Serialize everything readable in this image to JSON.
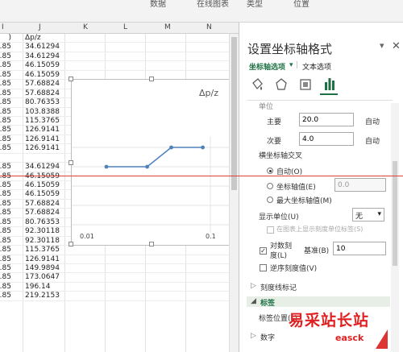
{
  "ribbon": {
    "items": [
      "数据",
      "在线图表",
      "类型",
      "位置"
    ]
  },
  "colhdr": {
    "I": "I",
    "J": "J",
    "K": "K",
    "L": "L",
    "M": "M",
    "N": "N"
  },
  "sheet": {
    "header_row": {
      "i": ")",
      "j": "Δp/z"
    },
    "rows": [
      {
        "i": "0.85",
        "j": "34.61294"
      },
      {
        "i": "0.85",
        "j": "34.61294"
      },
      {
        "i": "0.85",
        "j": "46.15059"
      },
      {
        "i": "0.85",
        "j": "46.15059"
      },
      {
        "i": "0.85",
        "j": "57.68824"
      },
      {
        "i": "0.85",
        "j": "57.68824"
      },
      {
        "i": "0.85",
        "j": "80.76353"
      },
      {
        "i": "0.85",
        "j": "103.8388"
      },
      {
        "i": "0.85",
        "j": "115.3765"
      },
      {
        "i": "0.85",
        "j": "126.9141"
      },
      {
        "i": "0.85",
        "j": "126.9141"
      },
      {
        "i": "0.85",
        "j": "126.9141"
      },
      {
        "i": "",
        "j": ""
      },
      {
        "i": "0.85",
        "j": "34.61294"
      },
      {
        "i": "0.85",
        "j": "46.15059"
      },
      {
        "i": "0.85",
        "j": "46.15059"
      },
      {
        "i": "0.85",
        "j": "46.15059"
      },
      {
        "i": "0.85",
        "j": "57.68824"
      },
      {
        "i": "0.85",
        "j": "57.68824"
      },
      {
        "i": "0.85",
        "j": "80.76353"
      },
      {
        "i": "0.85",
        "j": "92.30118"
      },
      {
        "i": "0.85",
        "j": "92.30118"
      },
      {
        "i": "0.85",
        "j": "115.3765"
      },
      {
        "i": "0.85",
        "j": "126.9141"
      },
      {
        "i": "0.85",
        "j": "149.9894"
      },
      {
        "i": "0.85",
        "j": "173.0647"
      },
      {
        "i": "0.85",
        "j": "196.14"
      },
      {
        "i": "0.85",
        "j": "219.2153"
      }
    ]
  },
  "chart": {
    "title": "Δp/z",
    "x_ticks": [
      "0.01",
      "0.1"
    ],
    "points": [
      [
        0.1,
        0.0
      ],
      [
        0.32,
        0.0
      ],
      [
        0.45,
        0.08
      ],
      [
        0.62,
        0.08
      ]
    ]
  },
  "pane": {
    "title": "设置坐标轴格式",
    "tab_axis": "坐标轴选项",
    "tab_text": "文本选项",
    "cut_label": "单位",
    "major_label": "主要",
    "major_value": "20.0",
    "major_auto": "自动",
    "minor_label": "次要",
    "minor_value": "4.0",
    "minor_auto": "自动",
    "cross_label": "横坐标轴交叉",
    "opt_auto": "自动(O)",
    "opt_value": "坐标轴值(E)",
    "opt_value_input": "0.0",
    "opt_max": "最大坐标轴值(M)",
    "display_unit_label": "显示单位(U)",
    "display_unit_value": "无",
    "show_unit_label": "在图表上显示刻度单位标签(S)",
    "log_label_1": "对数刻",
    "log_label_2": "度(L)",
    "log_base_label": "基准(B)",
    "log_base_value": "10",
    "reverse_label": "逆序刻度值(V)",
    "section_ticks": "刻度线标记",
    "section_labels": "标签",
    "label_pos": "标签位置(L)",
    "section_number": "数字"
  },
  "watermark": {
    "line1": "易采站长站",
    "line2": "easck"
  }
}
